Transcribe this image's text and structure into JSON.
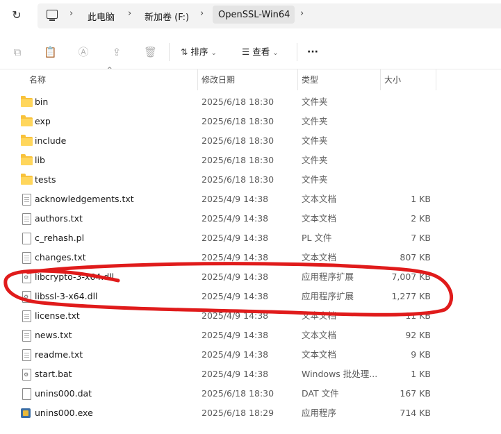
{
  "address": {
    "crumbs": [
      "此电脑",
      "新加卷 (F:)",
      "OpenSSL-Win64"
    ]
  },
  "toolbar": {
    "sort_label": "排序",
    "view_label": "查看",
    "more_label": "···"
  },
  "columns": {
    "name": "名称",
    "date": "修改日期",
    "type": "类型",
    "size": "大小"
  },
  "files": [
    {
      "name": "bin",
      "date": "2025/6/18 18:30",
      "type": "文件夹",
      "size": "",
      "icon": "folder-icon"
    },
    {
      "name": "exp",
      "date": "2025/6/18 18:30",
      "type": "文件夹",
      "size": "",
      "icon": "folder-icon"
    },
    {
      "name": "include",
      "date": "2025/6/18 18:30",
      "type": "文件夹",
      "size": "",
      "icon": "folder-icon"
    },
    {
      "name": "lib",
      "date": "2025/6/18 18:30",
      "type": "文件夹",
      "size": "",
      "icon": "folder-icon"
    },
    {
      "name": "tests",
      "date": "2025/6/18 18:30",
      "type": "文件夹",
      "size": "",
      "icon": "folder-icon"
    },
    {
      "name": "acknowledgements.txt",
      "date": "2025/4/9 14:38",
      "type": "文本文档",
      "size": "1 KB",
      "icon": "text-file-icon"
    },
    {
      "name": "authors.txt",
      "date": "2025/4/9 14:38",
      "type": "文本文档",
      "size": "2 KB",
      "icon": "text-file-icon"
    },
    {
      "name": "c_rehash.pl",
      "date": "2025/4/9 14:38",
      "type": "PL 文件",
      "size": "7 KB",
      "icon": "blank-file-icon"
    },
    {
      "name": "changes.txt",
      "date": "2025/4/9 14:38",
      "type": "文本文档",
      "size": "807 KB",
      "icon": "text-file-icon"
    },
    {
      "name": "libcrypto-3-x64.dll",
      "date": "2025/4/9 14:38",
      "type": "应用程序扩展",
      "size": "7,007 KB",
      "icon": "dll-file-icon"
    },
    {
      "name": "libssl-3-x64.dll",
      "date": "2025/4/9 14:38",
      "type": "应用程序扩展",
      "size": "1,277 KB",
      "icon": "dll-file-icon"
    },
    {
      "name": "license.txt",
      "date": "2025/4/9 14:38",
      "type": "文本文档",
      "size": "11 KB",
      "icon": "text-file-icon"
    },
    {
      "name": "news.txt",
      "date": "2025/4/9 14:38",
      "type": "文本文档",
      "size": "92 KB",
      "icon": "text-file-icon"
    },
    {
      "name": "readme.txt",
      "date": "2025/4/9 14:38",
      "type": "文本文档",
      "size": "9 KB",
      "icon": "text-file-icon"
    },
    {
      "name": "start.bat",
      "date": "2025/4/9 14:38",
      "type": "Windows 批处理...",
      "size": "1 KB",
      "icon": "bat-file-icon"
    },
    {
      "name": "unins000.dat",
      "date": "2025/6/18 18:30",
      "type": "DAT 文件",
      "size": "167 KB",
      "icon": "blank-file-icon"
    },
    {
      "name": "unins000.exe",
      "date": "2025/6/18 18:29",
      "type": "应用程序",
      "size": "714 KB",
      "icon": "exe-file-icon"
    }
  ],
  "annotation_color": "#e01b1b"
}
